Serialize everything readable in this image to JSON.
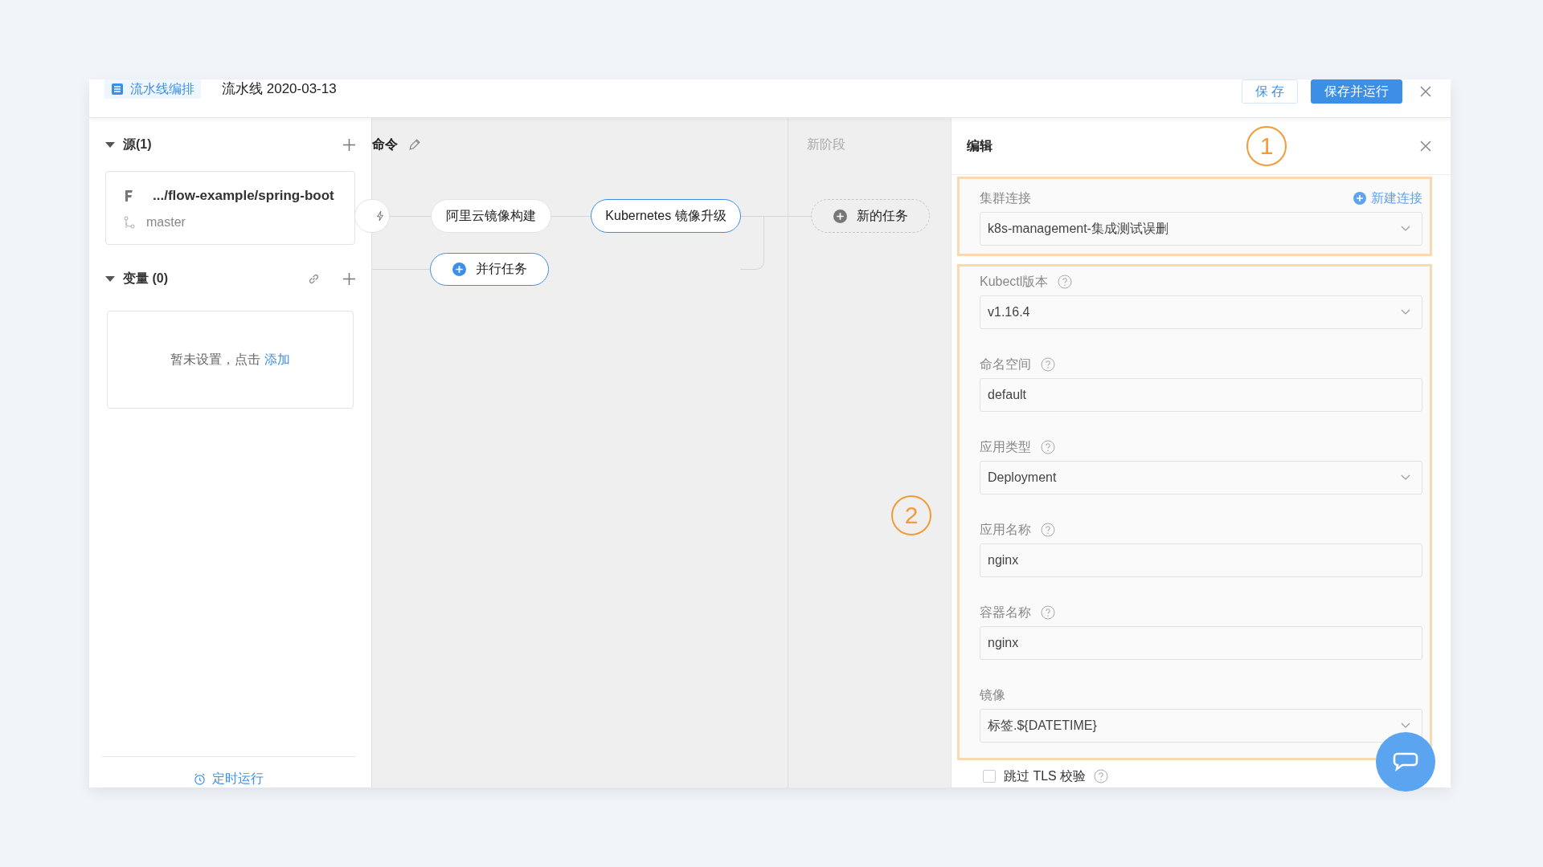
{
  "header": {
    "tab": {
      "label": "流水线编排",
      "selected": true
    },
    "title": "流水线 2020-03-13",
    "buttons": [
      {
        "label": "保 存",
        "kind": "default"
      },
      {
        "label": "保存并运行",
        "kind": "primary"
      }
    ]
  },
  "sidebar": {
    "sources": {
      "title": "源(1)",
      "expanded": true,
      "items": [
        {
          "repo": ".../flow-example/spring-boot",
          "branch": "master"
        }
      ]
    },
    "variables": {
      "title": "变量 (0)",
      "expanded": true,
      "empty_text": "暂未设置，点击",
      "add_link": "添加"
    },
    "footer_link": "定时运行"
  },
  "canvas": {
    "stages": [
      {
        "title": "命令",
        "kind": "stage",
        "tasks": [
          {
            "label": "阿里云镜像构建",
            "selected": false
          },
          {
            "label": "Kubernetes 镜像升级",
            "selected": true
          }
        ],
        "parallel_button": "并行任务"
      },
      {
        "title": "新阶段",
        "kind": "new",
        "add_task": "新的任务"
      }
    ]
  },
  "editor": {
    "title": "编辑",
    "groups": [
      {
        "fields": [
          {
            "label": "集群连接",
            "kind": "select",
            "value": "k8s-management-集成测试误删",
            "help": false,
            "action": "新建连接"
          }
        ]
      },
      {
        "fields": [
          {
            "label": "Kubectl版本",
            "kind": "select",
            "value": "v1.16.4",
            "help": true
          },
          {
            "label": "命名空间",
            "kind": "input",
            "value": "default",
            "help": true
          },
          {
            "label": "应用类型",
            "kind": "select",
            "value": "Deployment",
            "help": true
          },
          {
            "label": "应用名称",
            "kind": "input",
            "value": "nginx",
            "help": true
          },
          {
            "label": "容器名称",
            "kind": "input",
            "value": "nginx",
            "help": true
          },
          {
            "label": "镜像",
            "kind": "select",
            "value": "标签.${DATETIME}",
            "help": false
          }
        ]
      }
    ],
    "checkbox": {
      "label": "跳过 TLS 校验",
      "checked": false,
      "help": true
    }
  },
  "callouts": [
    "1",
    "2"
  ]
}
